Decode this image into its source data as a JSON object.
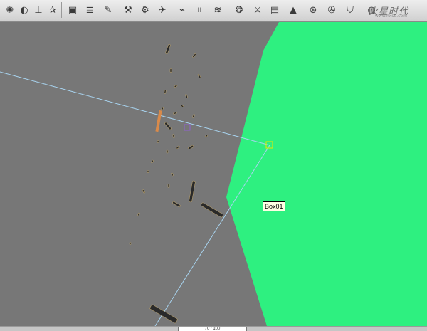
{
  "toolbar": {
    "icons": [
      {
        "name": "particle-system-icon",
        "glyph": "✺"
      },
      {
        "name": "soccer-ball-icon",
        "glyph": "◐"
      },
      {
        "name": "pushpin-icon",
        "glyph": "⊥"
      },
      {
        "name": "star-figure-icon",
        "glyph": "✰"
      },
      {
        "name": "display-panel-icon",
        "glyph": "▣"
      },
      {
        "name": "database-stack-icon",
        "glyph": "≣"
      },
      {
        "name": "brush-icon",
        "glyph": "✎"
      },
      {
        "name": "hammer-icon",
        "glyph": "⚒"
      },
      {
        "name": "gear-icon",
        "glyph": "⚙"
      },
      {
        "name": "plane-icon",
        "glyph": "✈"
      },
      {
        "name": "hand-dryer-icon",
        "glyph": "⌁"
      },
      {
        "name": "bridge-icon",
        "glyph": "⌗"
      },
      {
        "name": "wave-icon",
        "glyph": "≋"
      },
      {
        "name": "knot-icon",
        "glyph": "❂"
      },
      {
        "name": "toolset-icon",
        "glyph": "⚔"
      },
      {
        "name": "cylinder-icon",
        "glyph": "▤"
      },
      {
        "name": "cone-icon",
        "glyph": "▲"
      },
      {
        "name": "wheel-icon",
        "glyph": "⊛"
      },
      {
        "name": "fan-icon",
        "glyph": "✇"
      },
      {
        "name": "shirt-icon",
        "glyph": "⛉"
      },
      {
        "name": "globe-icon",
        "glyph": "◍"
      }
    ],
    "logo_text": "火星时代",
    "logo_url": "www.hxsd.com"
  },
  "viewport": {
    "object_label": "Box01",
    "background_color": "#777777",
    "plane_color": "#2ef080",
    "link_line_color": "#a8d4f0",
    "helper_color": "#e8e800"
  },
  "statusbar": {
    "coord_text": "70 / 100"
  }
}
